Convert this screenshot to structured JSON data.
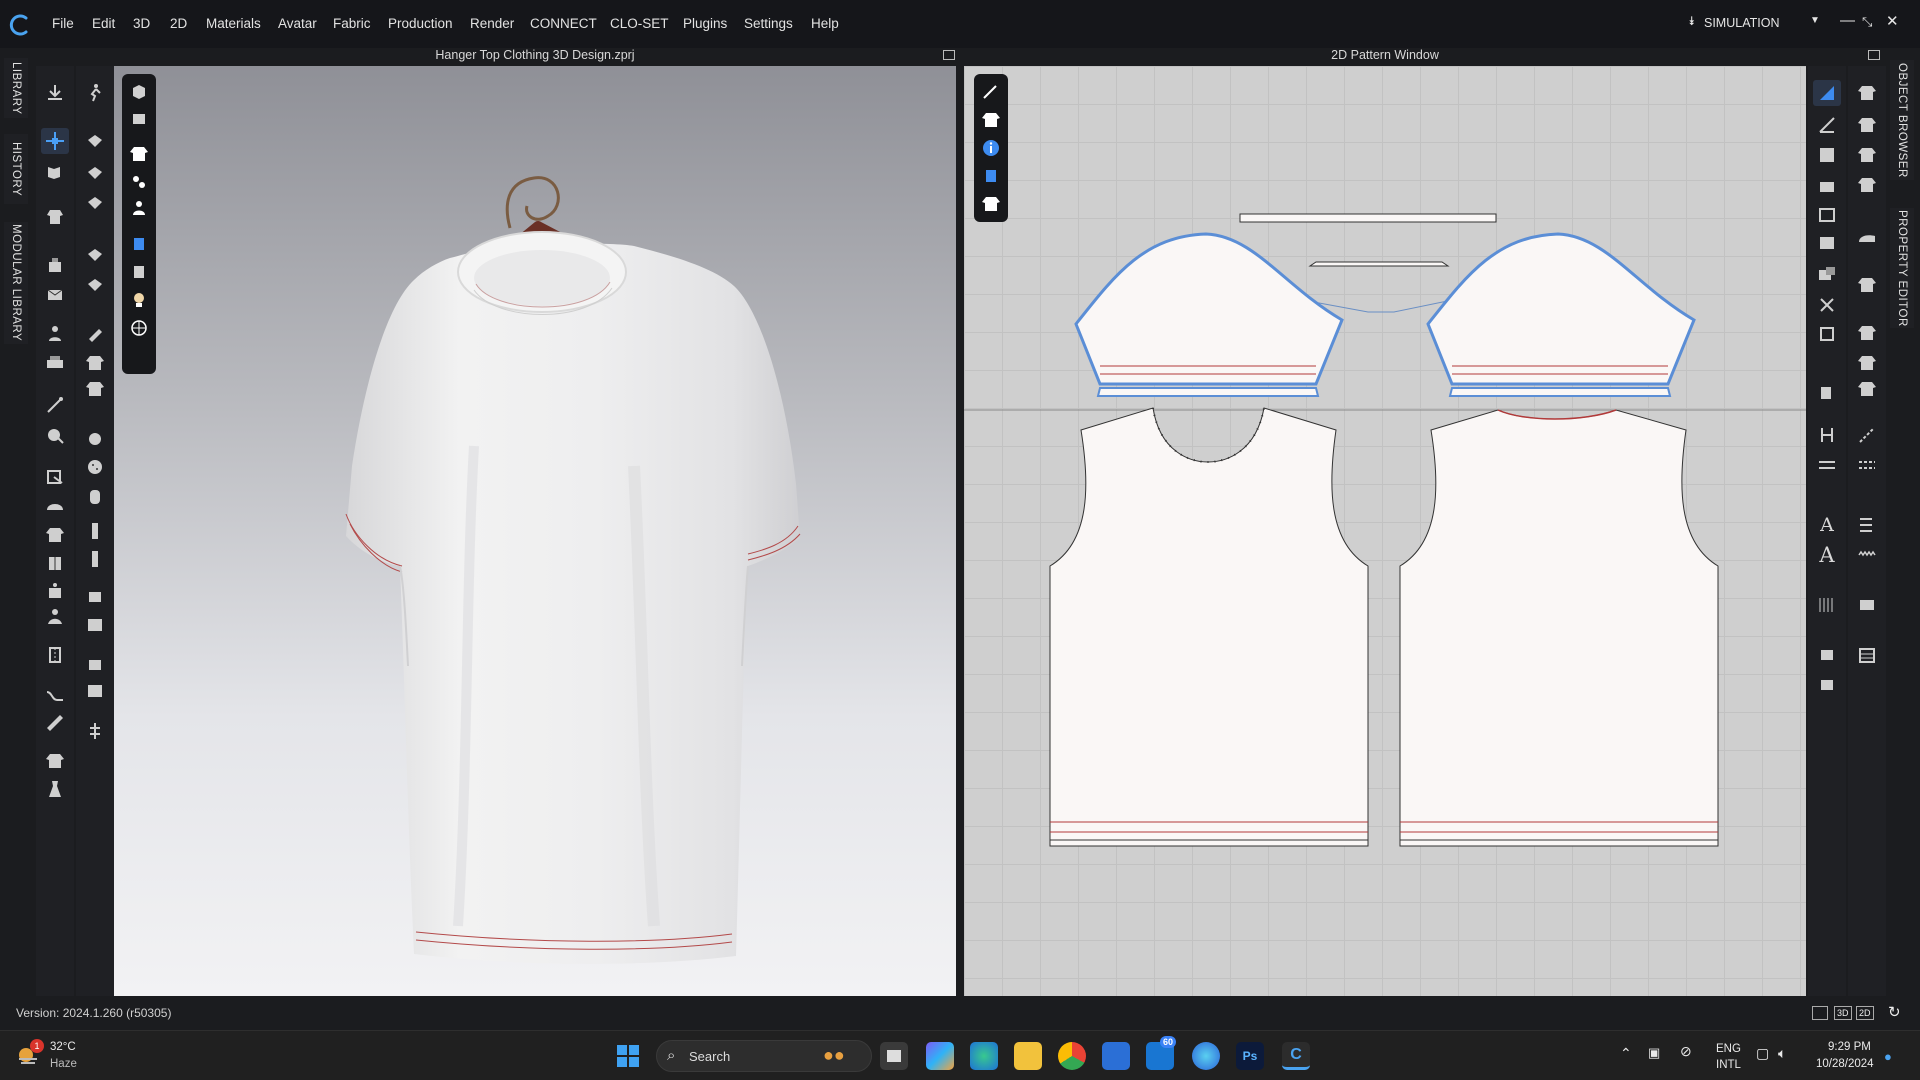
{
  "menubar": {
    "items": [
      "File",
      "Edit",
      "3D",
      "2D",
      "Materials",
      "Avatar",
      "Fabric",
      "Production",
      "Render",
      "CONNECT",
      "CLO-SET",
      "Plugins",
      "Settings",
      "Help"
    ],
    "mode_label": "SIMULATION"
  },
  "left_tabs": [
    "LIBRARY",
    "HISTORY",
    "MODULAR LIBRARY"
  ],
  "right_tabs": [
    "OBJECT BROWSER",
    "PROPERTY EDITOR"
  ],
  "viewport3d": {
    "title": "Hanger Top Clothing 3D Design.zprj"
  },
  "viewport2d": {
    "title": "2D Pattern Window"
  },
  "status": {
    "version": "Version: 2024.1.260 (r50305)",
    "view_buttons": [
      "3D",
      "2D"
    ]
  },
  "taskbar": {
    "weather": {
      "temp": "32°C",
      "condition": "Haze",
      "badge": "1"
    },
    "search_placeholder": "Search",
    "mail_badge": "60",
    "lang": "ENG",
    "lang_sub": "INTL",
    "time": "9:29 PM",
    "date": "10/28/2024"
  },
  "colors": {
    "accent": "#3d8bf0",
    "seam": "#b23a3a",
    "pattern_outline": "#5b8ed6",
    "fabric": "#faf7f6"
  }
}
